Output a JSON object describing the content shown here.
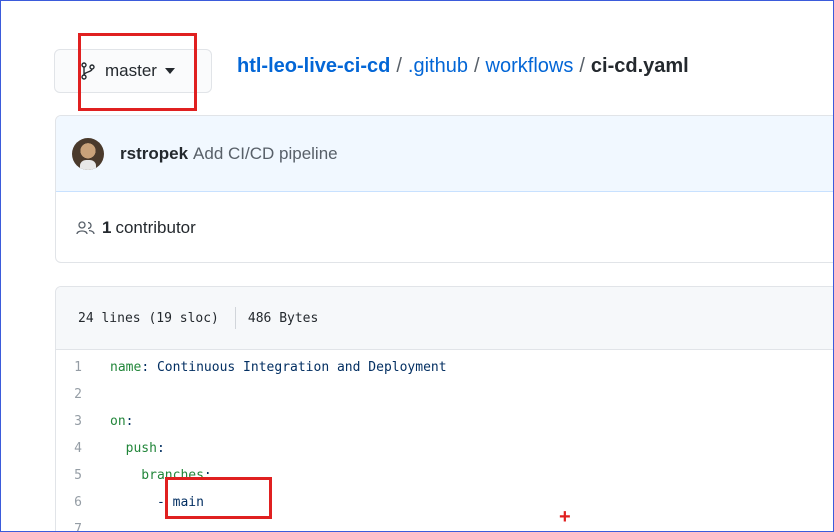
{
  "branch": {
    "label": "master"
  },
  "breadcrumb": {
    "repo": "htl-leo-live-ci-cd",
    "separator": "/",
    "folders": [
      ".github",
      "workflows"
    ],
    "file": "ci-cd.yaml"
  },
  "commit": {
    "author": "rstropek",
    "message": "Add CI/CD pipeline"
  },
  "contributors": {
    "count": "1",
    "label": "contributor"
  },
  "file_info": {
    "lines": "24 lines (19 sloc)",
    "size": "486 Bytes"
  },
  "code_lines": [
    {
      "number": "1",
      "key": "name",
      "rest": ": Continuous Integration and Deployment"
    },
    {
      "number": "2",
      "key": "",
      "rest": ""
    },
    {
      "number": "3",
      "key": "on",
      "rest": ":"
    },
    {
      "number": "4",
      "key": "  push",
      "rest": ":"
    },
    {
      "number": "5",
      "key": "    branches",
      "rest": ":"
    },
    {
      "number": "6",
      "key": "",
      "rest": "      - main"
    },
    {
      "number": "7",
      "key": "",
      "rest": ""
    }
  ],
  "colors": {
    "link": "#0366d6",
    "highlight": "#e02020",
    "yaml_key": "#22863a"
  },
  "icons": {
    "branch": "git-branch-icon",
    "caret": "caret-down-icon",
    "contributors": "people-icon"
  }
}
